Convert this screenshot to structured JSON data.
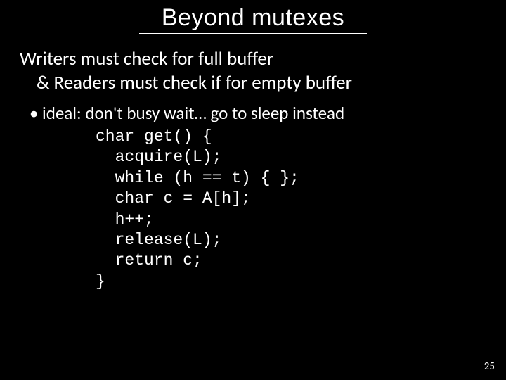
{
  "title": "Beyond mutexes",
  "lead": {
    "line1": "Writers must check for full buffer",
    "line2": "& Readers must check if for empty buffer"
  },
  "bullet": "ideal: don't busy wait… go to sleep instead",
  "code": "char get() {\n  acquire(L);\n  while (h == t) { };\n  char c = A[h];\n  h++;\n  release(L);\n  return c;\n}",
  "pageno": "25"
}
